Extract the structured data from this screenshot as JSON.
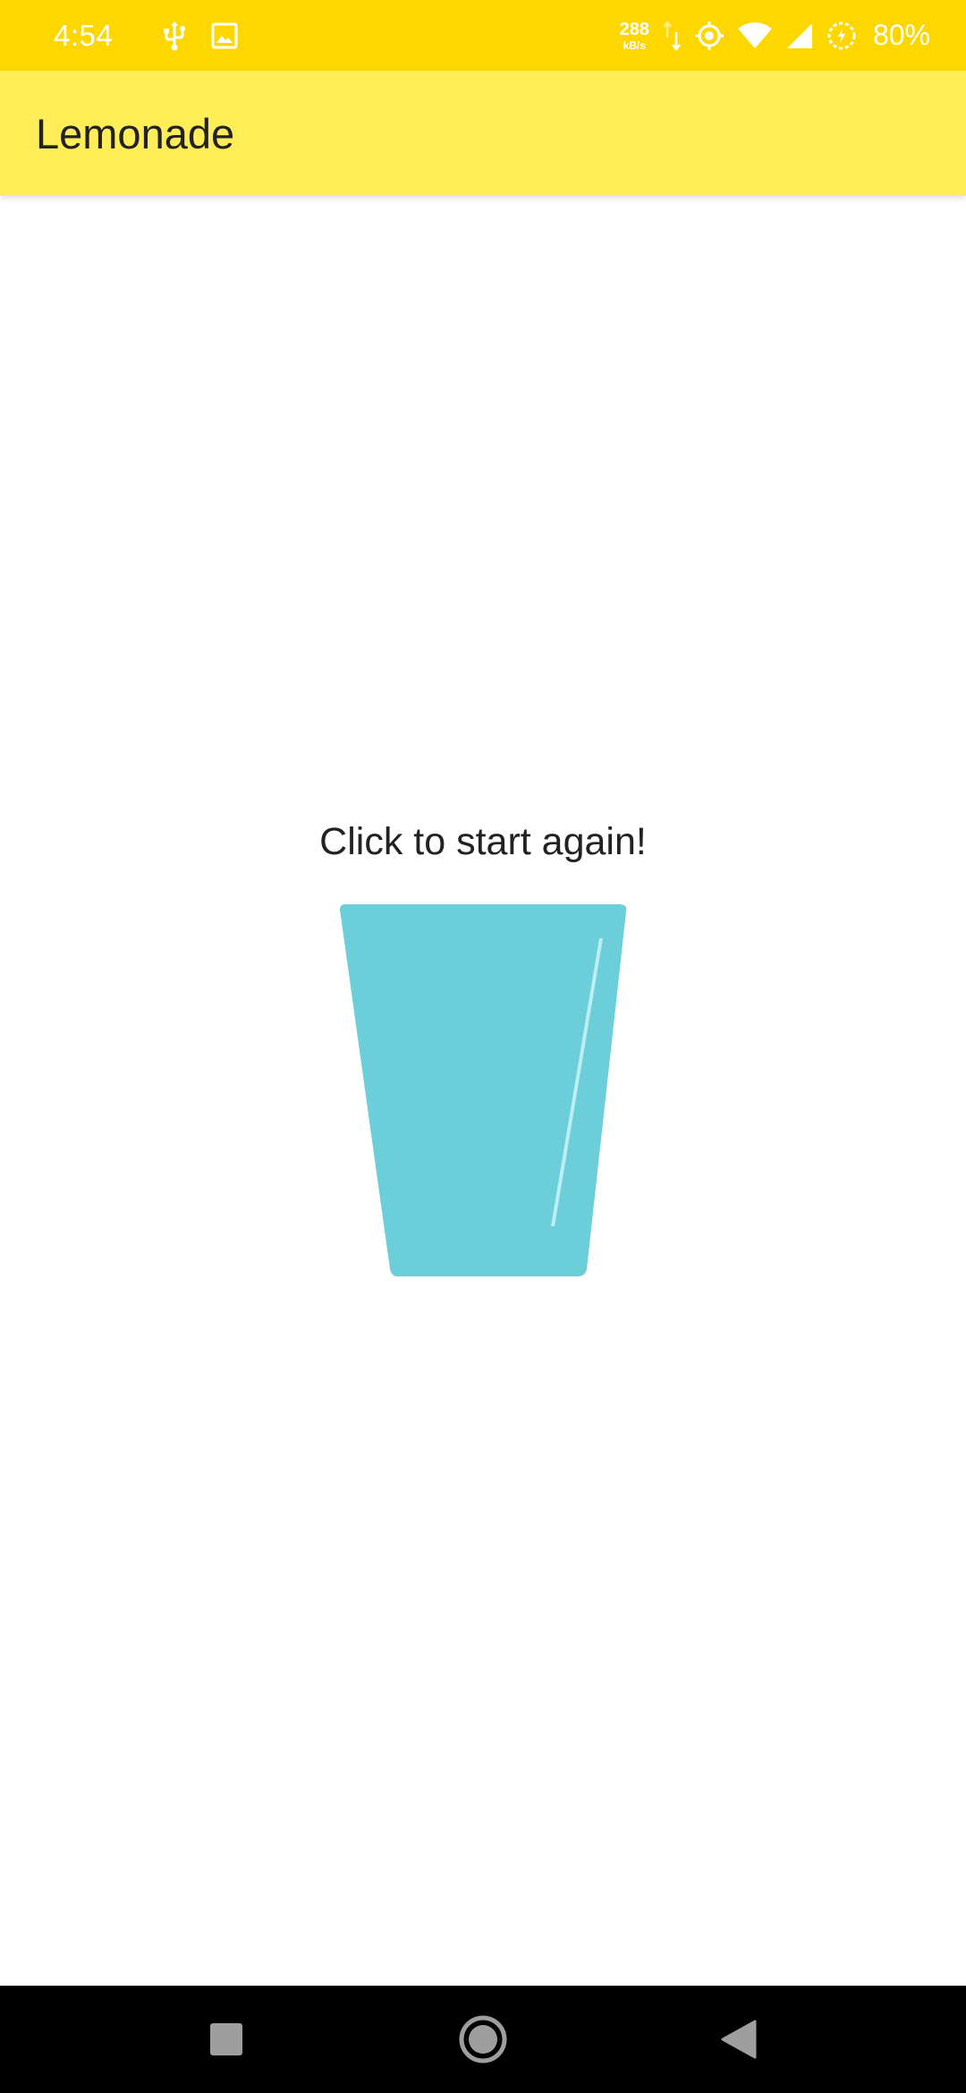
{
  "status_bar": {
    "time": "4:54",
    "net_speed_value": "288",
    "net_speed_unit": "kB/s",
    "battery": "80%",
    "icons": [
      "usb-icon",
      "image-icon",
      "data-activity-icon",
      "location-icon",
      "wifi-icon",
      "signal-icon",
      "battery-saver-icon"
    ],
    "background": "#FFD700"
  },
  "app_bar": {
    "title": "Lemonade",
    "background": "#FFEE58"
  },
  "main": {
    "instruction": "Click to start again!",
    "image": "empty-glass-icon",
    "glass_color": "#6BCED8"
  },
  "nav_bar": {
    "buttons": [
      "recents-button",
      "home-button",
      "back-button"
    ]
  }
}
